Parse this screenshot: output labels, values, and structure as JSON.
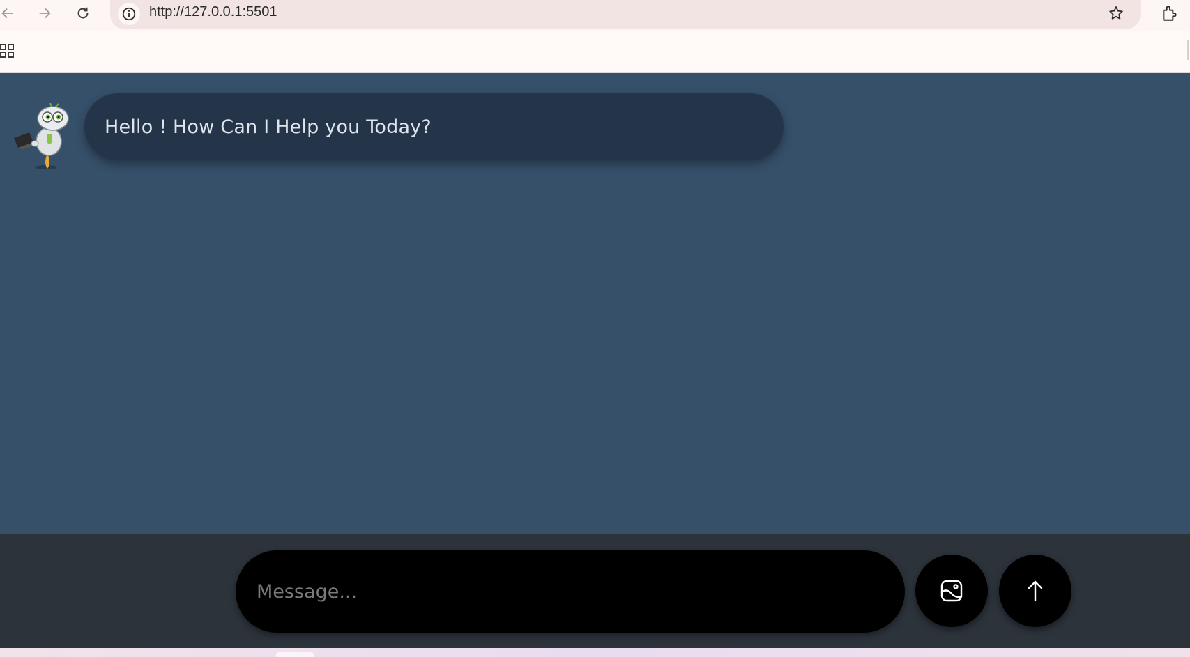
{
  "browser": {
    "back_icon": "arrow-left-icon",
    "forward_icon": "arrow-right-icon",
    "reload_icon": "reload-icon",
    "site_info_icon": "info-icon",
    "url": "http://127.0.0.1:5501",
    "bookmark_icon": "star-icon",
    "extensions_icon": "extensions-icon",
    "apps_icon": "apps-grid-icon"
  },
  "chat": {
    "bot_avatar": "robot-avatar",
    "messages": [
      {
        "sender": "bot",
        "text": "Hello ! How Can I Help you Today?"
      }
    ]
  },
  "composer": {
    "placeholder": "Message...",
    "value": "",
    "image_button_icon": "image-upload-icon",
    "send_button_icon": "arrow-up-icon"
  },
  "colors": {
    "chat_background": "#36506a",
    "bot_bubble": "#24354a",
    "composer_background": "#2c333b",
    "input_background": "#000000"
  }
}
